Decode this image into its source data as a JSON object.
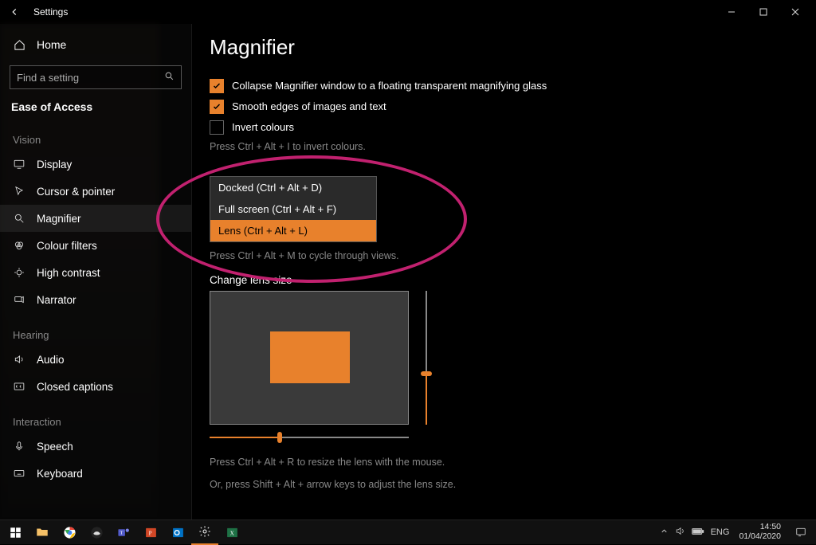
{
  "window": {
    "title": "Settings"
  },
  "sidebar": {
    "home": "Home",
    "search_placeholder": "Find a setting",
    "breadcrumb": "Ease of Access",
    "groups": [
      {
        "label": "Vision",
        "items": [
          "Display",
          "Cursor & pointer",
          "Magnifier",
          "Colour filters",
          "High contrast",
          "Narrator"
        ]
      },
      {
        "label": "Hearing",
        "items": [
          "Audio",
          "Closed captions"
        ]
      },
      {
        "label": "Interaction",
        "items": [
          "Speech",
          "Keyboard"
        ]
      }
    ],
    "active": "Magnifier"
  },
  "page": {
    "heading": "Magnifier",
    "checkbox1": "Collapse Magnifier window to a floating transparent magnifying glass",
    "checkbox2": "Smooth edges of images and text",
    "checkbox3": "Invert colours",
    "hint1": "Press Ctrl + Alt + I to invert colours.",
    "dropdown_options": [
      "Docked (Ctrl + Alt + D)",
      "Full screen (Ctrl + Alt + F)",
      "Lens (Ctrl + Alt + L)"
    ],
    "hint2": "Press Ctrl + Alt + M to cycle through views.",
    "lens_label": "Change lens size",
    "hint3": "Press Ctrl + Alt + R to resize the lens with the mouse.",
    "hint4": "Or, press Shift + Alt + arrow keys to adjust the lens size."
  },
  "taskbar": {
    "lang": "ENG",
    "time": "14:50",
    "date": "01/04/2020"
  }
}
